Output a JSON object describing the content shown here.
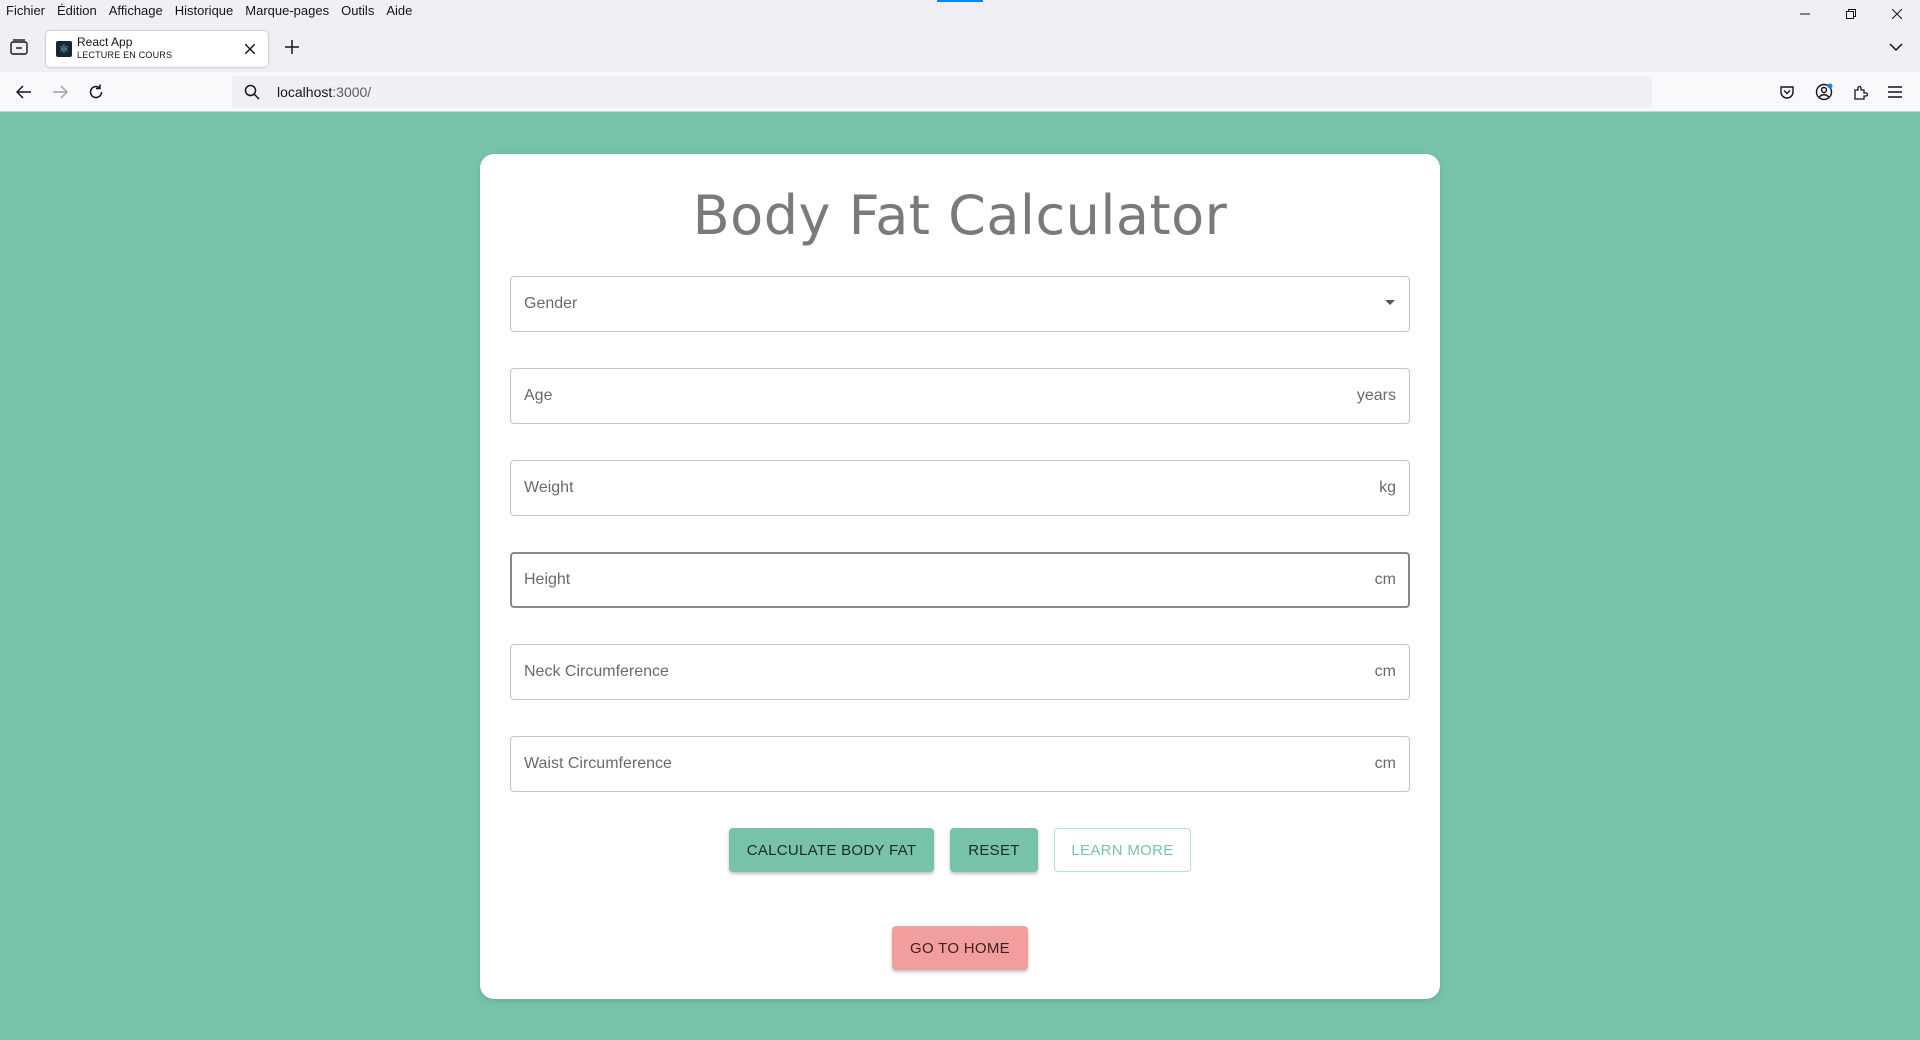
{
  "menubar": {
    "items": [
      {
        "label": "Fichier"
      },
      {
        "label": "Édition"
      },
      {
        "label": "Affichage"
      },
      {
        "label": "Historique"
      },
      {
        "label": "Marque-pages"
      },
      {
        "label": "Outils"
      },
      {
        "label": "Aide"
      }
    ]
  },
  "tab": {
    "title": "React App",
    "subtitle": "LECTURE EN COURS"
  },
  "urlbar": {
    "host": "localhost",
    "port_path": ":3000/"
  },
  "page": {
    "title": "Body Fat Calculator",
    "fields": {
      "gender": {
        "label": "Gender"
      },
      "age": {
        "label": "Age",
        "unit": "years"
      },
      "weight": {
        "label": "Weight",
        "unit": "kg"
      },
      "height": {
        "label": "Height",
        "unit": "cm"
      },
      "neck": {
        "label": "Neck Circumference",
        "unit": "cm"
      },
      "waist": {
        "label": "Waist Circumference",
        "unit": "cm"
      }
    },
    "buttons": {
      "calculate": "CALCULATE BODY FAT",
      "reset": "RESET",
      "learn_more": "LEARN MORE",
      "home": "GO TO HOME"
    }
  },
  "colors": {
    "background": "#77c2ab",
    "primary_button": "#77c2ab",
    "home_button": "#f29e9e"
  }
}
